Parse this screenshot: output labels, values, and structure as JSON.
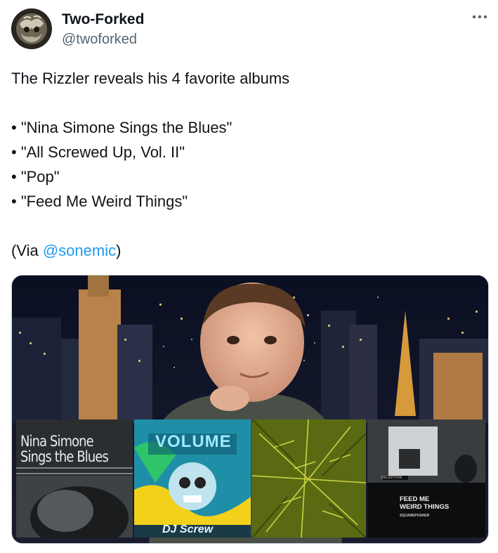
{
  "author": {
    "display_name": "Two-Forked",
    "handle": "@twoforked"
  },
  "tweet": {
    "intro": "The Rizzler reveals his 4 favorite albums",
    "albums": [
      "• \"Nina Simone Sings the Blues\"",
      "• \"All Screwed Up, Vol. II\"",
      "• \"Pop\"",
      "• \"Feed Me Weird Things\""
    ],
    "via_prefix": "(Via ",
    "via_mention": "@sonemic",
    "via_suffix": ")"
  },
  "media": {
    "covers": {
      "nina_title_line1": "Nina Simone",
      "nina_title_line2": "Sings the Blues",
      "screw_title": "VOLUME",
      "screw_artist": "DJ Screw",
      "feed_title_line1": "FEED ME",
      "feed_title_line2": "WEIRD THINGS",
      "feed_artist": "SQUAREPUSHER",
      "feed_sign": "RECEPTION"
    }
  },
  "icons": {
    "more": "more-horizontal-icon"
  },
  "colors": {
    "link": "#1d9bf0",
    "secondary_text": "#536471",
    "primary_text": "#0f1419"
  }
}
